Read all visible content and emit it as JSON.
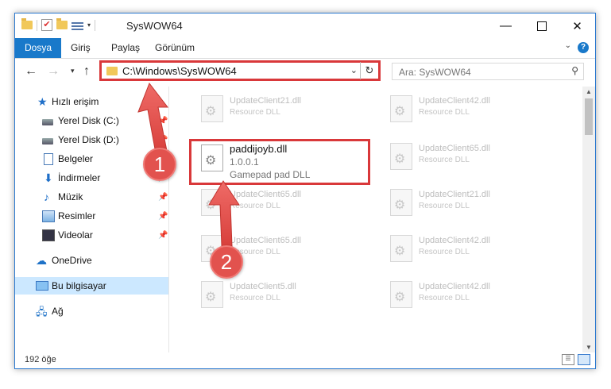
{
  "window": {
    "title": "SysWOW64",
    "minimize_icon": "minimize-icon",
    "maximize_icon": "maximize-icon",
    "close_icon": "close-icon"
  },
  "ribbon": {
    "tabs": [
      {
        "label": "Dosya",
        "active": true
      },
      {
        "label": "Giriş"
      },
      {
        "label": "Paylaş"
      },
      {
        "label": "Görünüm"
      }
    ],
    "help_label": "?"
  },
  "address": {
    "path": "C:\\Windows\\SysWOW64",
    "search_placeholder": "Ara: SysWOW64"
  },
  "nav": {
    "items": [
      {
        "label": "Hızlı erişim",
        "icon": "star-icon"
      },
      {
        "label": "Yerel Disk (C:)",
        "icon": "disk-icon",
        "pinned": true
      },
      {
        "label": "Yerel Disk (D:)",
        "icon": "disk-icon",
        "pinned": true
      },
      {
        "label": "Belgeler",
        "icon": "document-icon",
        "pinned": true
      },
      {
        "label": "İndirmeler",
        "icon": "download-icon",
        "pinned": true
      },
      {
        "label": "Müzik",
        "icon": "music-icon",
        "pinned": true
      },
      {
        "label": "Resimler",
        "icon": "pictures-icon",
        "pinned": true
      },
      {
        "label": "Videolar",
        "icon": "videos-icon",
        "pinned": true
      },
      {
        "label": "OneDrive",
        "icon": "cloud-icon"
      },
      {
        "label": "Bu bilgisayar",
        "icon": "computer-icon",
        "selected": true
      },
      {
        "label": "Ağ",
        "icon": "network-icon"
      }
    ]
  },
  "files": {
    "left_column": [
      {
        "name": "UpdateClient21.dll",
        "type": "Resource DLL"
      },
      {
        "name": "paddijoyb.dll",
        "version": "1.0.0.1",
        "type": "Gamepad pad DLL",
        "highlighted": true
      },
      {
        "name": "UpdateClient65.dll",
        "type": "Resource DLL"
      },
      {
        "name": "UpdateClient65.dll",
        "type": "Resource DLL"
      },
      {
        "name": "UpdateClient5.dll",
        "type": "Resource DLL"
      }
    ],
    "right_column": [
      {
        "name": "UpdateClient42.dll",
        "type": "Resource DLL"
      },
      {
        "name": "UpdateClient65.dll",
        "type": "Resource DLL"
      },
      {
        "name": "UpdateClient21.dll",
        "type": "Resource DLL"
      },
      {
        "name": "UpdateClient42.dll",
        "type": "Resource DLL"
      },
      {
        "name": "UpdateClient42.dll",
        "type": "Resource DLL"
      }
    ]
  },
  "status": {
    "item_count": "192 öğe"
  },
  "annotations": {
    "step1": "1",
    "step2": "2",
    "color": "#e2524e"
  }
}
